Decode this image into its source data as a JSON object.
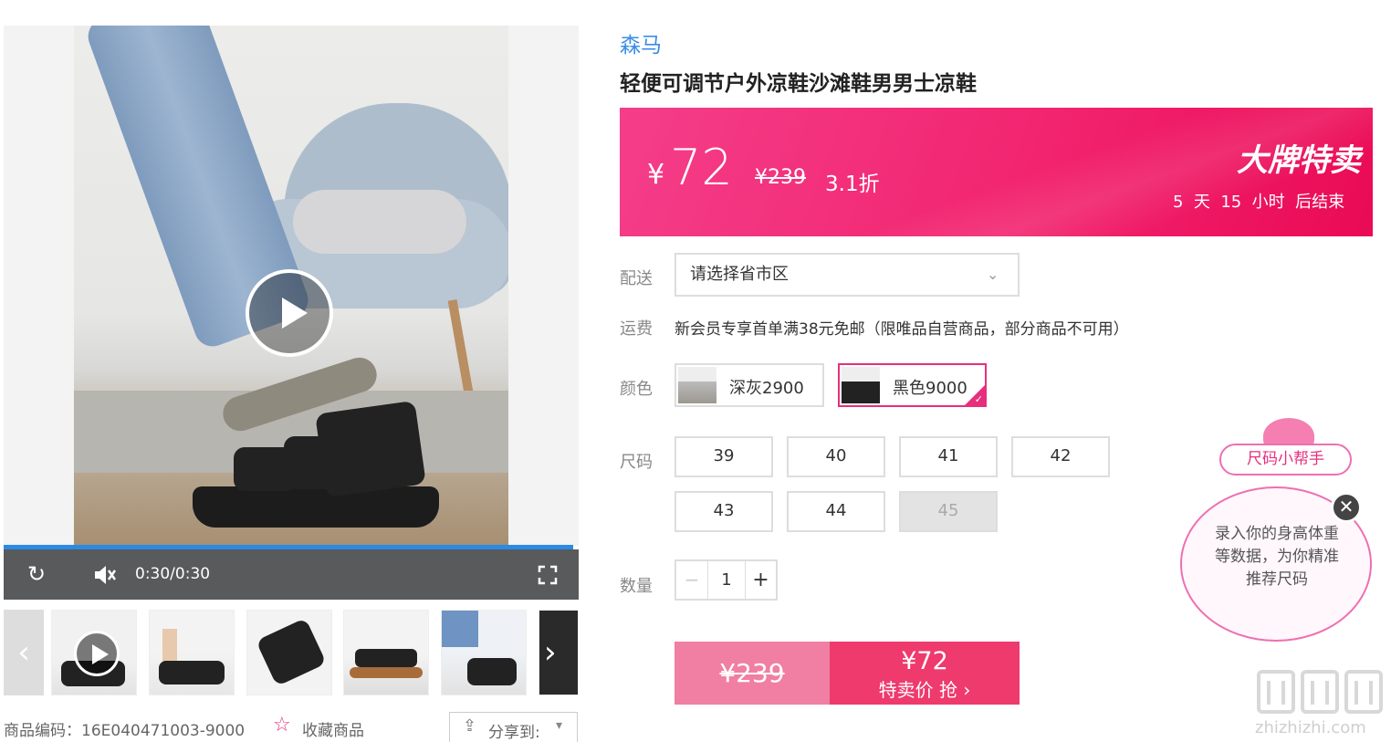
{
  "gallery": {
    "time": "0:30/0:30",
    "product_code": "商品编码：16E040471003-9000",
    "favorite_label": "收藏商品",
    "share_label": "分享到:"
  },
  "product": {
    "brand": "森马",
    "title": "轻便可调节户外凉鞋沙滩鞋男男士凉鞋"
  },
  "promo": {
    "currency": "¥",
    "price": "72",
    "original_price": "¥239",
    "discount": "3.1折",
    "badge": "大牌特卖",
    "countdown": "5  天  15  小时  后结束",
    "colors": {
      "start": "#f43e8a",
      "end": "#ea0a55"
    }
  },
  "delivery": {
    "label": "配送",
    "select_value": "请选择省市区"
  },
  "shipping": {
    "label": "运费",
    "text": "新会员专享首单满38元免邮（限唯品自营商品，部分商品不可用）"
  },
  "color": {
    "label": "颜色",
    "options": [
      {
        "name": "深灰2900",
        "selected": false
      },
      {
        "name": "黑色9000",
        "selected": true
      }
    ],
    "selected_border": "#e62f7d"
  },
  "size": {
    "label": "尺码",
    "options": [
      "39",
      "40",
      "41",
      "42",
      "43",
      "44",
      "45"
    ],
    "disabled": [
      "45"
    ]
  },
  "quantity": {
    "label": "数量",
    "minus": "−",
    "value": "1",
    "plus": "+"
  },
  "buy_button": {
    "original_price": "¥239",
    "price": "¥72",
    "action": "特卖价 抢 ›"
  },
  "size_helper": {
    "tag": "尺码小帮手",
    "message": "录入你的身高体重等数据，为你精准推荐尺码",
    "close": "✕"
  },
  "watermark": {
    "logo": "值值值",
    "url": "zhizhizhi.com"
  }
}
